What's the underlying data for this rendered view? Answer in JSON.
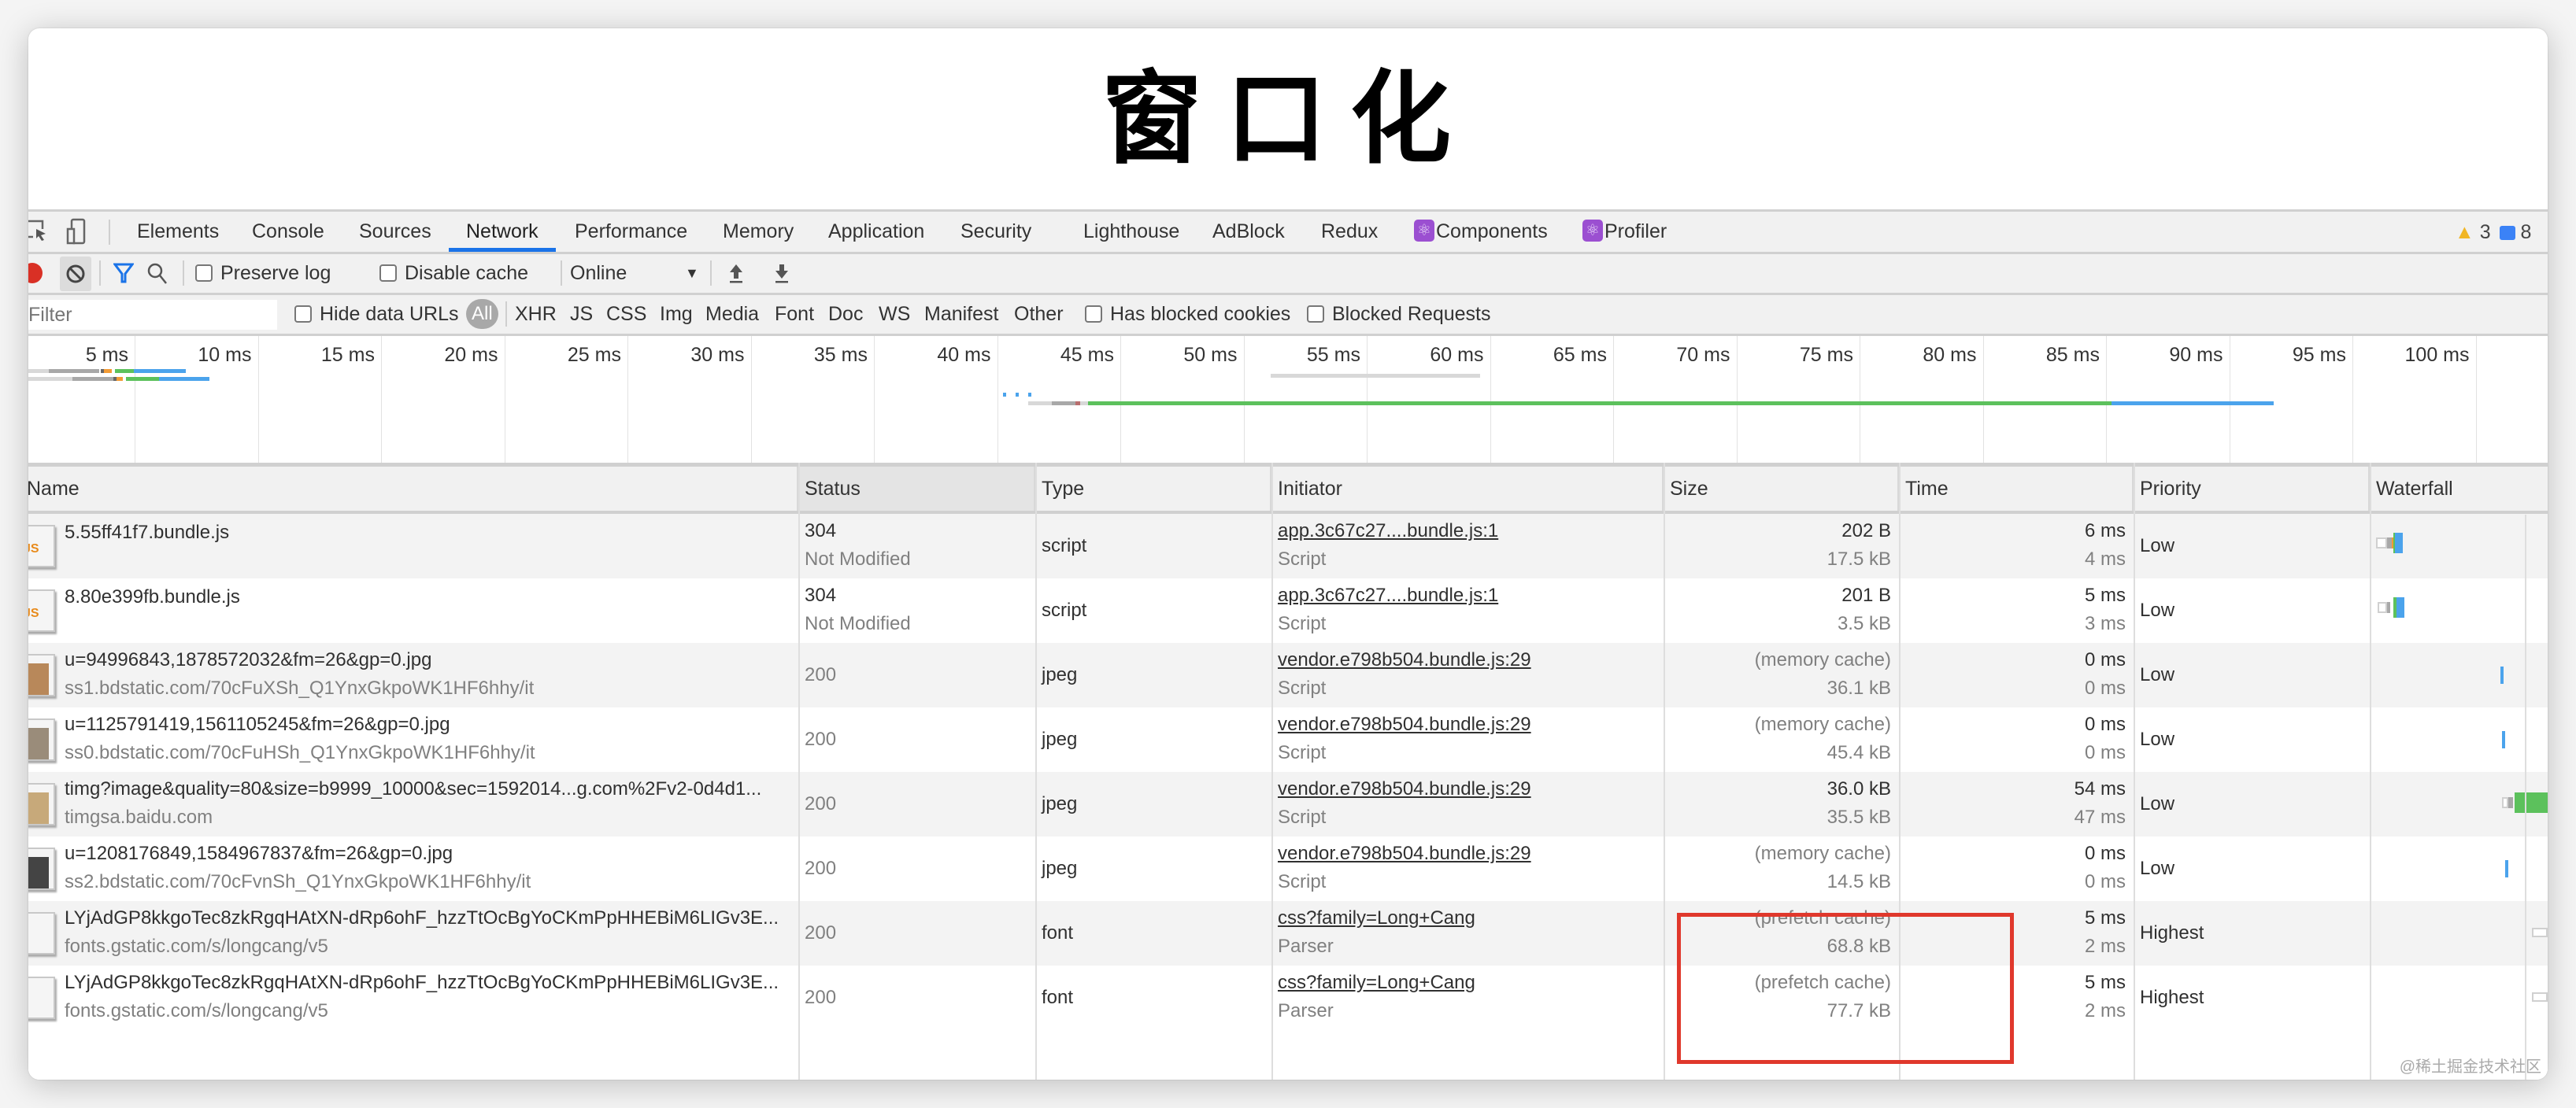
{
  "page": {
    "title": "窗口化",
    "watermark": "@稀土掘金技术社区"
  },
  "tabs": [
    {
      "label": "Elements"
    },
    {
      "label": "Console"
    },
    {
      "label": "Sources"
    },
    {
      "label": "Network",
      "active": true
    },
    {
      "label": "Performance"
    },
    {
      "label": "Memory"
    },
    {
      "label": "Application"
    },
    {
      "label": "Security"
    },
    {
      "label": "Lighthouse"
    },
    {
      "label": "AdBlock"
    },
    {
      "label": "Redux"
    },
    {
      "label": "Components",
      "icon": "react-icon"
    },
    {
      "label": "Profiler",
      "icon": "react-icon"
    }
  ],
  "badges": {
    "warnings": "3",
    "messages": "8"
  },
  "toolbar": {
    "preserve_log": "Preserve log",
    "disable_cache": "Disable cache",
    "throttle": "Online",
    "preserve_log_checked": false,
    "disable_cache_checked": false
  },
  "filterbar": {
    "placeholder": "Filter",
    "hide_data_urls": "Hide data URLs",
    "types": [
      "All",
      "XHR",
      "JS",
      "CSS",
      "Img",
      "Media",
      "Font",
      "Doc",
      "WS",
      "Manifest",
      "Other"
    ],
    "active_type": "All",
    "has_blocked_cookies": "Has blocked cookies",
    "blocked_requests": "Blocked Requests"
  },
  "overview": {
    "ticks": [
      "5 ms",
      "10 ms",
      "15 ms",
      "20 ms",
      "25 ms",
      "30 ms",
      "35 ms",
      "40 ms",
      "45 ms",
      "50 ms",
      "55 ms",
      "60 ms",
      "65 ms",
      "70 ms",
      "75 ms",
      "80 ms",
      "85 ms",
      "90 ms",
      "95 ms",
      "100 ms",
      "10"
    ],
    "colors": {
      "queue": "#d8d8d8",
      "stalled": "#a8a8a8",
      "ssl": "#f29b35",
      "waiting": "#5cc15c",
      "download": "#4ba3ec"
    }
  },
  "table": {
    "columns": [
      "Name",
      "Status",
      "Type",
      "Initiator",
      "Size",
      "Time",
      "Priority",
      "Waterfall"
    ],
    "sorted_column": "Status",
    "rows": [
      {
        "icon": "js-file-icon",
        "name": "5.55ff41f7.bundle.js",
        "path": "",
        "status": "304",
        "status_text": "Not Modified",
        "type": "script",
        "initiator": "app.3c67c27....bundle.js:1",
        "initiator_type": "Script",
        "size": "202 B",
        "resource_size": "17.5 kB",
        "time": "6 ms",
        "latency": "4 ms",
        "priority": "Low"
      },
      {
        "icon": "js-file-icon",
        "name": "8.80e399fb.bundle.js",
        "path": "",
        "status": "304",
        "status_text": "Not Modified",
        "type": "script",
        "initiator": "app.3c67c27....bundle.js:1",
        "initiator_type": "Script",
        "size": "201 B",
        "resource_size": "3.5 kB",
        "time": "5 ms",
        "latency": "3 ms",
        "priority": "Low"
      },
      {
        "icon": "image-thumbnail",
        "name": "u=94996843,1878572032&fm=26&gp=0.jpg",
        "path": "ss1.bdstatic.com/70cFuXSh_Q1YnxGkpoWK1HF6hhy/it",
        "status": "200",
        "status_text": "",
        "type": "jpeg",
        "initiator": "vendor.e798b504.bundle.js:29",
        "initiator_type": "Script",
        "size": "(memory cache)",
        "resource_size": "36.1 kB",
        "time": "0 ms",
        "latency": "0 ms",
        "priority": "Low"
      },
      {
        "icon": "image-thumbnail",
        "name": "u=1125791419,1561105245&fm=26&gp=0.jpg",
        "path": "ss0.bdstatic.com/70cFuHSh_Q1YnxGkpoWK1HF6hhy/it",
        "status": "200",
        "status_text": "",
        "type": "jpeg",
        "initiator": "vendor.e798b504.bundle.js:29",
        "initiator_type": "Script",
        "size": "(memory cache)",
        "resource_size": "45.4 kB",
        "time": "0 ms",
        "latency": "0 ms",
        "priority": "Low"
      },
      {
        "icon": "image-thumbnail",
        "name": "timg?image&quality=80&size=b9999_10000&sec=1592014...g.com%2Fv2-0d4d1...",
        "path": "timgsa.baidu.com",
        "status": "200",
        "status_text": "",
        "type": "jpeg",
        "initiator": "vendor.e798b504.bundle.js:29",
        "initiator_type": "Script",
        "size": "36.0 kB",
        "resource_size": "35.5 kB",
        "time": "54 ms",
        "latency": "47 ms",
        "priority": "Low"
      },
      {
        "icon": "image-thumbnail",
        "name": "u=1208176849,1584967837&fm=26&gp=0.jpg",
        "path": "ss2.bdstatic.com/70cFvnSh_Q1YnxGkpoWK1HF6hhy/it",
        "status": "200",
        "status_text": "",
        "type": "jpeg",
        "initiator": "vendor.e798b504.bundle.js:29",
        "initiator_type": "Script",
        "size": "(memory cache)",
        "resource_size": "14.5 kB",
        "time": "0 ms",
        "latency": "0 ms",
        "priority": "Low"
      },
      {
        "icon": "font-file-icon",
        "name": "LYjAdGP8kkgoTec8zkRgqHAtXN-dRp6ohF_hzzTtOcBgYoCKmPpHHEBiM6LIGv3E...",
        "path": "fonts.gstatic.com/s/longcang/v5",
        "status": "200",
        "status_text": "",
        "type": "font",
        "initiator": "css?family=Long+Cang",
        "initiator_type": "Parser",
        "size": "(prefetch cache)",
        "resource_size": "68.8 kB",
        "time": "5 ms",
        "latency": "2 ms",
        "priority": "Highest"
      },
      {
        "icon": "font-file-icon",
        "name": "LYjAdGP8kkgoTec8zkRgqHAtXN-dRp6ohF_hzzTtOcBgYoCKmPpHHEBiM6LIGv3E...",
        "path": "fonts.gstatic.com/s/longcang/v5",
        "status": "200",
        "status_text": "",
        "type": "font",
        "initiator": "css?family=Long+Cang",
        "initiator_type": "Parser",
        "size": "(prefetch cache)",
        "resource_size": "77.7 kB",
        "time": "5 ms",
        "latency": "2 ms",
        "priority": "Highest"
      }
    ]
  },
  "annotation": {
    "label": "highlighted-prefetch-cache",
    "color": "#e0382c"
  }
}
